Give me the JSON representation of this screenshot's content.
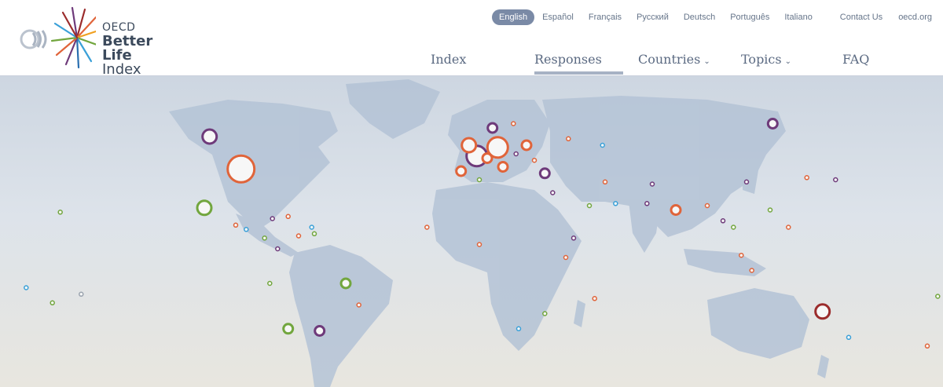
{
  "logo": {
    "line1": "OECD",
    "line2": "Better Life",
    "line3": "Index"
  },
  "languages": [
    {
      "label": "English",
      "active": true
    },
    {
      "label": "Español",
      "active": false
    },
    {
      "label": "Français",
      "active": false
    },
    {
      "label": "Русский",
      "active": false
    },
    {
      "label": "Deutsch",
      "active": false
    },
    {
      "label": "Português",
      "active": false
    },
    {
      "label": "Italiano",
      "active": false
    }
  ],
  "top_links": {
    "contact": "Contact Us",
    "oecd": "oecd.org"
  },
  "nav": {
    "index": "Index",
    "responses": "Responses",
    "countries": "Countries",
    "topics": "Topics",
    "faq": "FAQ",
    "active": "Responses"
  },
  "colors": {
    "land": "#b4c3d6",
    "orange": "#e0643a",
    "purple": "#6e3a7a",
    "green": "#72a63e",
    "blue": "#3aa0d8",
    "darkred": "#9b2c2c",
    "grey": "#9aa3ae"
  },
  "map": {
    "markers": [
      {
        "lon": -88,
        "lat": 41,
        "size": "xl",
        "color": "orange"
      },
      {
        "lon": -100,
        "lat": 56,
        "size": "m",
        "color": "purple"
      },
      {
        "lon": -102,
        "lat": 23,
        "size": "m",
        "color": "green"
      },
      {
        "lon": 134,
        "lat": -25,
        "size": "m",
        "color": "darkred"
      },
      {
        "lon": 115,
        "lat": 62,
        "size": "s",
        "color": "purple"
      },
      {
        "lon": -48,
        "lat": -12,
        "size": "s",
        "color": "green"
      },
      {
        "lon": 2,
        "lat": 47,
        "size": "l",
        "color": "purple"
      },
      {
        "lon": 10,
        "lat": 51,
        "size": "l",
        "color": "orange"
      },
      {
        "lon": -1,
        "lat": 52,
        "size": "m",
        "color": "orange"
      },
      {
        "lon": 6,
        "lat": 46,
        "size": "s",
        "color": "orange"
      },
      {
        "lon": -4,
        "lat": 40,
        "size": "s",
        "color": "orange"
      },
      {
        "lon": 12,
        "lat": 42,
        "size": "s",
        "color": "orange"
      },
      {
        "lon": 8,
        "lat": 60,
        "size": "s",
        "color": "purple"
      },
      {
        "lon": 16,
        "lat": 62,
        "size": "xs",
        "color": "orange"
      },
      {
        "lon": 21,
        "lat": 52,
        "size": "s",
        "color": "orange"
      },
      {
        "lon": 17,
        "lat": 48,
        "size": "xs",
        "color": "purple"
      },
      {
        "lon": 24,
        "lat": 45,
        "size": "xs",
        "color": "orange"
      },
      {
        "lon": 28,
        "lat": 39,
        "size": "s",
        "color": "purple"
      },
      {
        "lon": 37,
        "lat": 55,
        "size": "xs",
        "color": "orange"
      },
      {
        "lon": 50,
        "lat": 52,
        "size": "xs",
        "color": "blue"
      },
      {
        "lon": 78,
        "lat": 22,
        "size": "s",
        "color": "orange"
      },
      {
        "lon": 105,
        "lat": 35,
        "size": "xs",
        "color": "purple"
      },
      {
        "lon": 139,
        "lat": 36,
        "size": "xs",
        "color": "purple"
      },
      {
        "lon": 128,
        "lat": 37,
        "size": "xs",
        "color": "orange"
      },
      {
        "lon": 114,
        "lat": 22,
        "size": "xs",
        "color": "green"
      },
      {
        "lon": 121,
        "lat": 14,
        "size": "xs",
        "color": "orange"
      },
      {
        "lon": 103,
        "lat": 1,
        "size": "xs",
        "color": "orange"
      },
      {
        "lon": 107,
        "lat": -6,
        "size": "xs",
        "color": "orange"
      },
      {
        "lon": 174,
        "lat": -41,
        "size": "xs",
        "color": "orange"
      },
      {
        "lon": -43,
        "lat": -22,
        "size": "xs",
        "color": "orange"
      },
      {
        "lon": -70,
        "lat": -33,
        "size": "s",
        "color": "green"
      },
      {
        "lon": -58,
        "lat": -34,
        "size": "s",
        "color": "purple"
      },
      {
        "lon": -74,
        "lat": 4,
        "size": "xs",
        "color": "purple"
      },
      {
        "lon": -77,
        "lat": -12,
        "size": "xs",
        "color": "green"
      },
      {
        "lon": -66,
        "lat": 10,
        "size": "xs",
        "color": "orange"
      },
      {
        "lon": -79,
        "lat": 9,
        "size": "xs",
        "color": "green"
      },
      {
        "lon": -90,
        "lat": 15,
        "size": "xs",
        "color": "orange"
      },
      {
        "lon": -86,
        "lat": 13,
        "size": "xs",
        "color": "blue"
      },
      {
        "lon": -76,
        "lat": 18,
        "size": "xs",
        "color": "purple"
      },
      {
        "lon": -70,
        "lat": 19,
        "size": "xs",
        "color": "orange"
      },
      {
        "lon": -61,
        "lat": 14,
        "size": "xs",
        "color": "blue"
      },
      {
        "lon": -60,
        "lat": 11,
        "size": "xs",
        "color": "green"
      },
      {
        "lon": 31,
        "lat": 30,
        "size": "xs",
        "color": "purple"
      },
      {
        "lon": 3,
        "lat": 36,
        "size": "xs",
        "color": "green"
      },
      {
        "lon": -17,
        "lat": 14,
        "size": "xs",
        "color": "orange"
      },
      {
        "lon": 3,
        "lat": 6,
        "size": "xs",
        "color": "orange"
      },
      {
        "lon": 36,
        "lat": 0,
        "size": "xs",
        "color": "orange"
      },
      {
        "lon": 39,
        "lat": 9,
        "size": "xs",
        "color": "purple"
      },
      {
        "lon": 28,
        "lat": -26,
        "size": "xs",
        "color": "green"
      },
      {
        "lon": 18,
        "lat": -33,
        "size": "xs",
        "color": "blue"
      },
      {
        "lon": 47,
        "lat": -19,
        "size": "xs",
        "color": "orange"
      },
      {
        "lon": 45,
        "lat": 24,
        "size": "xs",
        "color": "green"
      },
      {
        "lon": 55,
        "lat": 25,
        "size": "xs",
        "color": "blue"
      },
      {
        "lon": 51,
        "lat": 35,
        "size": "xs",
        "color": "orange"
      },
      {
        "lon": 69,
        "lat": 34,
        "size": "xs",
        "color": "purple"
      },
      {
        "lon": 67,
        "lat": 25,
        "size": "xs",
        "color": "purple"
      },
      {
        "lon": 90,
        "lat": 24,
        "size": "xs",
        "color": "orange"
      },
      {
        "lon": 100,
        "lat": 14,
        "size": "xs",
        "color": "green"
      },
      {
        "lon": 96,
        "lat": 17,
        "size": "xs",
        "color": "purple"
      },
      {
        "lon": 144,
        "lat": -37,
        "size": "xs",
        "color": "blue"
      },
      {
        "lon": 178,
        "lat": -18,
        "size": "xs",
        "color": "green"
      },
      {
        "lon": -157,
        "lat": 21,
        "size": "xs",
        "color": "green"
      },
      {
        "lon": -170,
        "lat": -14,
        "size": "xs",
        "color": "blue"
      },
      {
        "lon": -160,
        "lat": -21,
        "size": "xs",
        "color": "green"
      },
      {
        "lon": -149,
        "lat": -17,
        "size": "xs",
        "color": "grey"
      }
    ]
  }
}
